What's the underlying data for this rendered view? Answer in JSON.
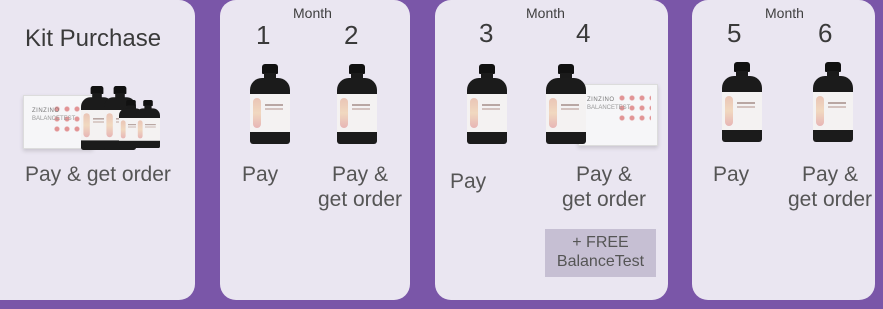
{
  "kit": {
    "title": "Kit Purchase",
    "label": "Pay & get order",
    "box_brand": "ZINZINO",
    "box_name": "BALANCETEST"
  },
  "month_word": "Month",
  "group1": {
    "num_a": "1",
    "num_b": "2",
    "label_a": "Pay",
    "label_b_line1": "Pay &",
    "label_b_line2": "get order"
  },
  "group2": {
    "num_a": "3",
    "num_b": "4",
    "label_a": "Pay",
    "label_b_line1": "Pay &",
    "label_b_line2": "get order",
    "badge_line1": "+ FREE",
    "badge_line2": "BalanceTest",
    "box_brand": "ZINZINO",
    "box_name": "BALANCETEST"
  },
  "group3": {
    "num_a": "5",
    "num_b": "6",
    "label_a": "Pay",
    "label_b_line1": "Pay &",
    "label_b_line2": "get order"
  },
  "colors": {
    "background": "#7a56a8",
    "panel": "#eae6f1",
    "badge": "#c6bfd3"
  }
}
